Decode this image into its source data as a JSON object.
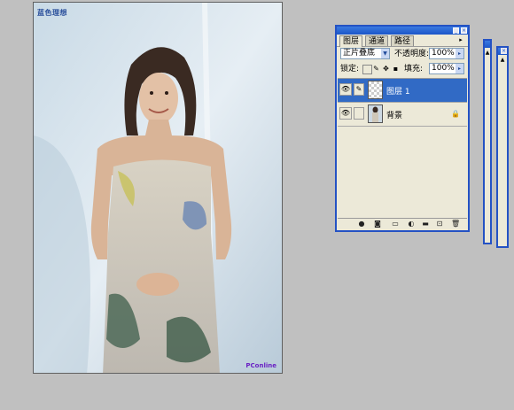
{
  "canvas": {
    "watermark_top": "蓝色理想",
    "watermark_bottom": "PConline"
  },
  "layers_panel": {
    "tabs": [
      {
        "label": "图层",
        "active": true
      },
      {
        "label": "通道",
        "active": false
      },
      {
        "label": "路径",
        "active": false
      }
    ],
    "blend_mode": "正片叠底",
    "opacity_label": "不透明度:",
    "opacity_value": "100%",
    "lock_label": "锁定:",
    "fill_label": "填充:",
    "fill_value": "100%",
    "layers": [
      {
        "name": "图层 1",
        "selected": true,
        "visible": true,
        "thumbnail": "transparent",
        "locked": false
      },
      {
        "name": "背景",
        "selected": false,
        "visible": true,
        "thumbnail": "photo",
        "locked": true
      }
    ],
    "bottom_icons": [
      "link-layers-icon",
      "layer-style-icon",
      "layer-mask-icon",
      "new-group-icon",
      "adjustment-layer-icon",
      "new-layer-icon",
      "trash-icon"
    ]
  },
  "colors": {
    "titlebar": "#1c56c8",
    "selection": "#316ac5",
    "panel_bg": "#ece9d8",
    "workspace": "#c0c0c0"
  }
}
